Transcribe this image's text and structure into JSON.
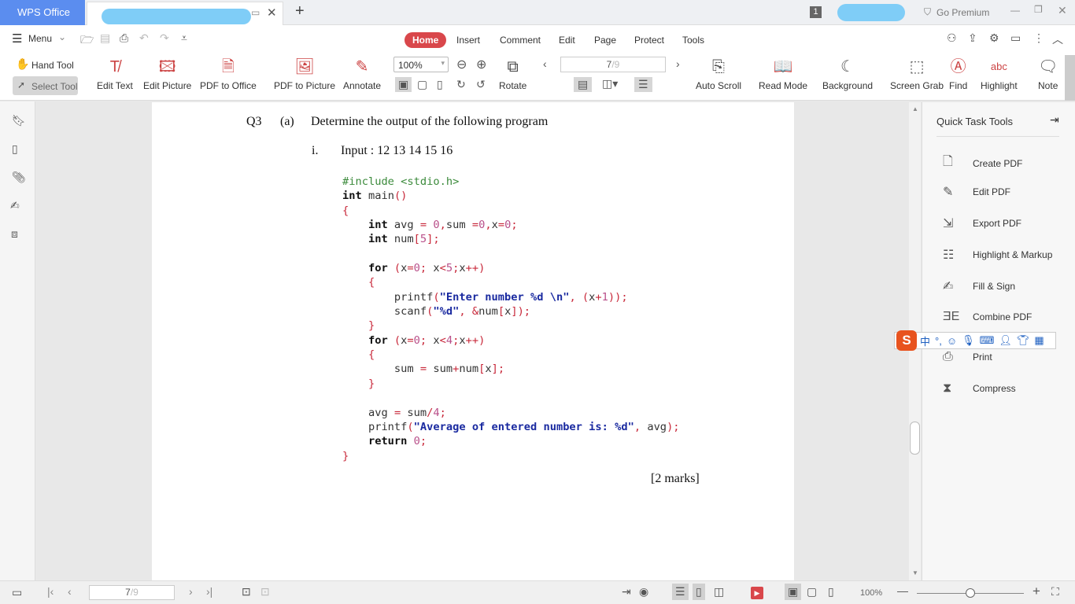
{
  "app": {
    "title": "WPS Office",
    "notif_count": "1",
    "go_premium": "Go Premium"
  },
  "menu": {
    "label": "Menu",
    "tabs": [
      "Home",
      "Insert",
      "Comment",
      "Edit",
      "Page",
      "Protect",
      "Tools"
    ],
    "active_tab": "Home"
  },
  "toolbar": {
    "hand_tool": "Hand Tool",
    "select_tool": "Select Tool",
    "items": [
      "Edit Text",
      "Edit Picture",
      "PDF to Office",
      "PDF to Picture",
      "Annotate"
    ],
    "zoom": "100%",
    "rotate": "Rotate",
    "page_current": "7",
    "page_total": "/9",
    "right_items": [
      "Auto Scroll",
      "Read Mode",
      "Background",
      "Screen Grab",
      "Find",
      "Highlight",
      "Note"
    ]
  },
  "document": {
    "question": "Q3",
    "part": "(a)",
    "prompt": "Determine the output of the following program",
    "sub": "i.",
    "input": "Input : 12 13 14 15 16",
    "marks": "[2 marks]",
    "code": [
      [
        [
          "#include <stdio.h>",
          "g"
        ]
      ],
      [
        [
          "int",
          "k"
        ],
        [
          " main",
          "d"
        ],
        [
          "()",
          "p"
        ]
      ],
      [
        [
          "{",
          "p"
        ]
      ],
      [
        [
          "    int",
          "k"
        ],
        [
          " avg ",
          "d"
        ],
        [
          "=",
          "p"
        ],
        [
          " 0",
          "n"
        ],
        [
          ",",
          "p"
        ],
        [
          "sum ",
          "d"
        ],
        [
          "=",
          "p"
        ],
        [
          "0",
          "n"
        ],
        [
          ",",
          "p"
        ],
        [
          "x",
          "d"
        ],
        [
          "=",
          "p"
        ],
        [
          "0",
          "n"
        ],
        [
          ";",
          "p"
        ]
      ],
      [
        [
          "    int",
          "k"
        ],
        [
          " num",
          "d"
        ],
        [
          "[",
          "p"
        ],
        [
          "5",
          "n"
        ],
        [
          "];",
          "p"
        ]
      ],
      [
        [
          "",
          ""
        ]
      ],
      [
        [
          "    for",
          "k"
        ],
        [
          " (",
          "p"
        ],
        [
          "x",
          "d"
        ],
        [
          "=",
          "p"
        ],
        [
          "0",
          "n"
        ],
        [
          ";",
          "p"
        ],
        [
          " x",
          "d"
        ],
        [
          "<",
          "p"
        ],
        [
          "5",
          "n"
        ],
        [
          ";",
          "p"
        ],
        [
          "x",
          "d"
        ],
        [
          "++)",
          "p"
        ]
      ],
      [
        [
          "    {",
          "p"
        ]
      ],
      [
        [
          "        printf",
          "d"
        ],
        [
          "(",
          "p"
        ],
        [
          "\"Enter number %d \\n\"",
          "s"
        ],
        [
          ", (",
          "p"
        ],
        [
          "x",
          "d"
        ],
        [
          "+",
          "p"
        ],
        [
          "1",
          "n"
        ],
        [
          "));",
          "p"
        ]
      ],
      [
        [
          "        scanf",
          "d"
        ],
        [
          "(",
          "p"
        ],
        [
          "\"%d\"",
          "s"
        ],
        [
          ", &",
          "p"
        ],
        [
          "num",
          "d"
        ],
        [
          "[",
          "p"
        ],
        [
          "x",
          "d"
        ],
        [
          "]);",
          "p"
        ]
      ],
      [
        [
          "    }",
          "p"
        ]
      ],
      [
        [
          "    for",
          "k"
        ],
        [
          " (",
          "p"
        ],
        [
          "x",
          "d"
        ],
        [
          "=",
          "p"
        ],
        [
          "0",
          "n"
        ],
        [
          ";",
          "p"
        ],
        [
          " x",
          "d"
        ],
        [
          "<",
          "p"
        ],
        [
          "4",
          "n"
        ],
        [
          ";",
          "p"
        ],
        [
          "x",
          "d"
        ],
        [
          "++)",
          "p"
        ]
      ],
      [
        [
          "    {",
          "p"
        ]
      ],
      [
        [
          "        sum ",
          "d"
        ],
        [
          "=",
          "p"
        ],
        [
          " sum",
          "d"
        ],
        [
          "+",
          "p"
        ],
        [
          "num",
          "d"
        ],
        [
          "[",
          "p"
        ],
        [
          "x",
          "d"
        ],
        [
          "];",
          "p"
        ]
      ],
      [
        [
          "    }",
          "p"
        ]
      ],
      [
        [
          "",
          ""
        ]
      ],
      [
        [
          "    avg ",
          "d"
        ],
        [
          "=",
          "p"
        ],
        [
          " sum",
          "d"
        ],
        [
          "/",
          "p"
        ],
        [
          "4",
          "n"
        ],
        [
          ";",
          "p"
        ]
      ],
      [
        [
          "    printf",
          "d"
        ],
        [
          "(",
          "p"
        ],
        [
          "\"Average of entered number is: %d\"",
          "s"
        ],
        [
          ", ",
          "p"
        ],
        [
          "avg",
          "d"
        ],
        [
          ");",
          "p"
        ]
      ],
      [
        [
          "    return",
          "k"
        ],
        [
          " 0",
          "n"
        ],
        [
          ";",
          "p"
        ]
      ],
      [
        [
          "}",
          "p"
        ]
      ]
    ]
  },
  "quick_tools": {
    "title": "Quick Task Tools",
    "items": [
      "Create PDF",
      "Edit PDF",
      "Export PDF",
      "Highlight & Markup",
      "Fill & Sign",
      "Combine PDF",
      "Print",
      "Compress"
    ]
  },
  "statusbar": {
    "page_current": "7",
    "page_total": "/9",
    "zoom": "100%",
    "zoom_level": 0.5
  },
  "colors": {
    "accent": "#d9474b",
    "wps_blue": "#5b8def"
  }
}
